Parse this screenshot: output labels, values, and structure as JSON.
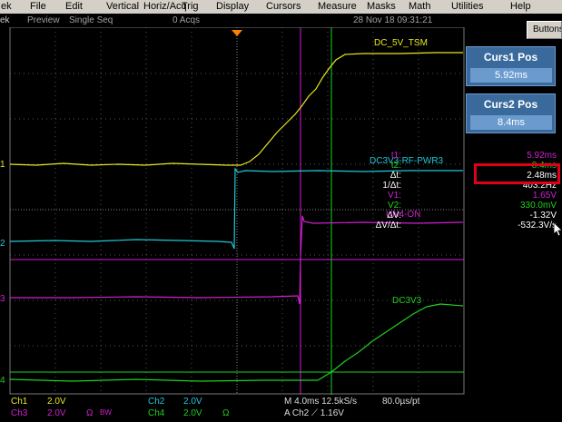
{
  "menu": {
    "items": [
      "ek",
      "File",
      "Edit",
      "Vertical",
      "Horiz/Acq",
      "Trig",
      "Display",
      "Cursors",
      "Measure",
      "Masks",
      "Math",
      "Utilities",
      "Help"
    ]
  },
  "status": {
    "mode": "Preview",
    "seq": "Single Seq",
    "acqs": "0 Acqs",
    "datetime": "28 Nov 18 09:31:21"
  },
  "buttons_label": "Buttons",
  "cursors": {
    "curs1": {
      "title": "Curs1 Pos",
      "value": "5.92ms"
    },
    "curs2": {
      "title": "Curs2 Pos",
      "value": "8.4ms"
    }
  },
  "readouts": [
    {
      "label": "t1:",
      "value": "5.92ms",
      "color": "#d020d0"
    },
    {
      "label": "t2:",
      "value": "8.4ms",
      "color": "#20d020"
    },
    {
      "label": "Δt:",
      "value": "2.48ms",
      "color": "#ffffff"
    },
    {
      "label": "1/Δt:",
      "value": "403.2Hz",
      "color": "#ffffff"
    },
    {
      "label": "V1:",
      "value": "1.65V",
      "color": "#d020d0"
    },
    {
      "label": "V2:",
      "value": "330.0mV",
      "color": "#20d020"
    },
    {
      "label": "ΔV:",
      "value": "-1.32V",
      "color": "#ffffff"
    },
    {
      "label": "ΔV/Δt:",
      "value": "-532.3V/s",
      "color": "#ffffff"
    }
  ],
  "traces": {
    "ch1_label": "DC_5V_TSM",
    "ch2_label": "DC3V3-RF-PWR3",
    "ch3_label": "UN4-ON",
    "ch4_label": "DC3V3",
    "marker1": "1",
    "marker2": "2",
    "marker3": "3",
    "marker4": "4"
  },
  "bottom": {
    "ch1": "Ch1",
    "ch1_scale": "2.0V",
    "ch2": "Ch2",
    "ch2_scale": "2.0V",
    "ch3": "Ch3",
    "ch3_scale": "2.0V",
    "ch3_imp": "Ω",
    "ch3_bw": "BW",
    "ch4": "Ch4",
    "ch4_scale": "2.0V",
    "ch4_imp": "Ω",
    "timebase": "M 4.0ms 12.5kS/s",
    "res": "80.0µs/pt",
    "trigger": "A  Ch2  ⟋  1.16V"
  },
  "colors": {
    "ch1": "#e8e820",
    "ch2": "#20c8d8",
    "ch3": "#d020d0",
    "ch4": "#20d020",
    "accent": "#3a6a9c",
    "highlight": "#e0001a"
  }
}
